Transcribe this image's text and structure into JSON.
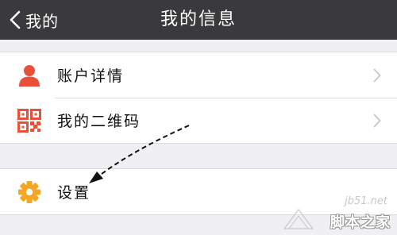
{
  "navbar": {
    "back_label": "我的",
    "title": "我的信息"
  },
  "group1": {
    "items": [
      {
        "label": "账户详情",
        "icon": "person-icon",
        "color": "#e8503a"
      },
      {
        "label": "我的二维码",
        "icon": "qr-code-icon",
        "color": "#e8503a"
      }
    ]
  },
  "group2": {
    "items": [
      {
        "label": "设置",
        "icon": "gear-icon",
        "color": "#f5a623"
      }
    ]
  },
  "watermark": {
    "url": "jb51.net",
    "name": "脚本之家"
  },
  "colors": {
    "navbar_bg": "#3a3a3c",
    "page_bg": "#efeff4",
    "chevron": "#c7c7cc"
  }
}
